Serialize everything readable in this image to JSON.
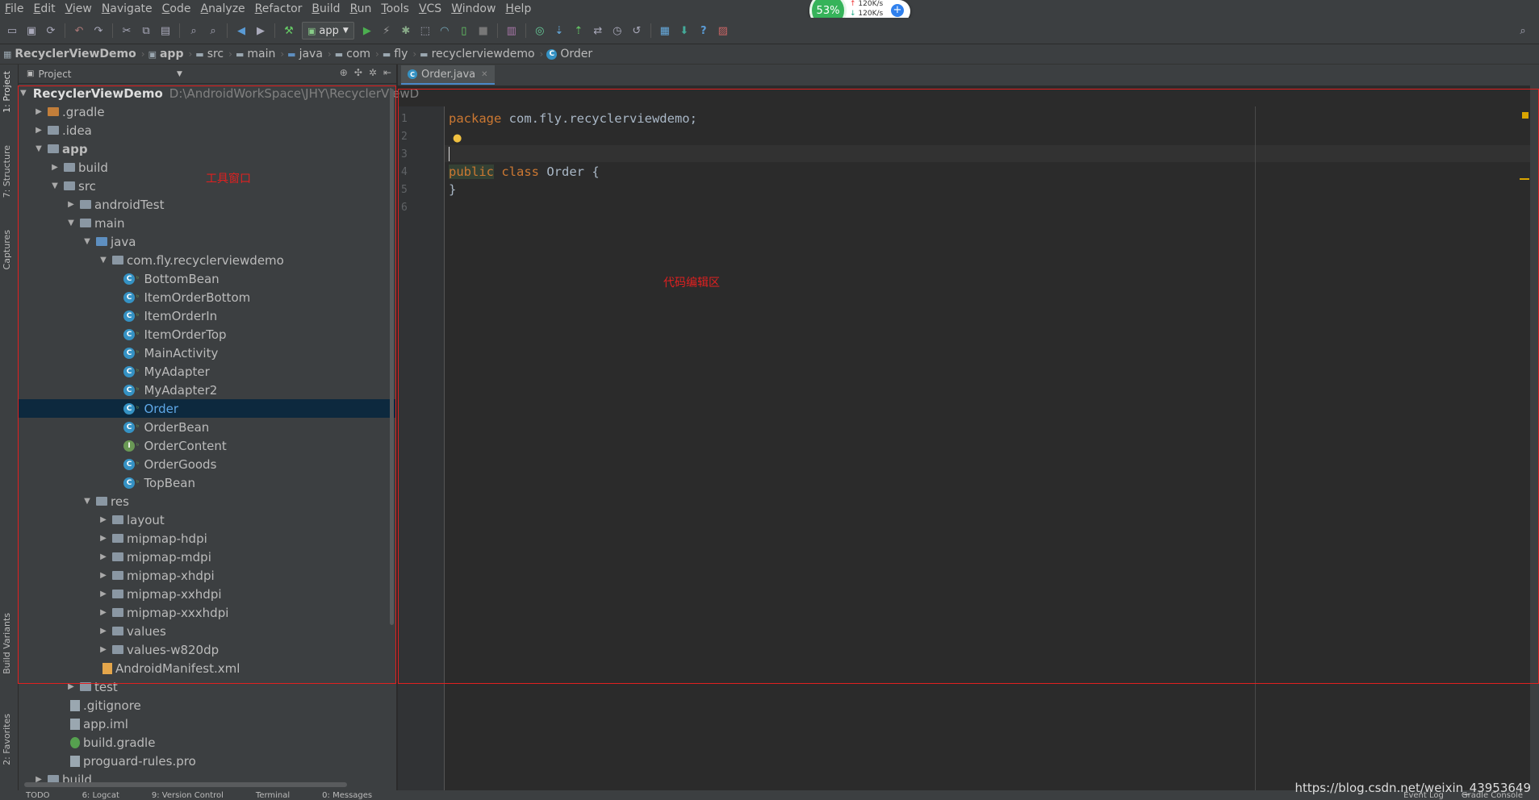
{
  "menu": [
    "File",
    "Edit",
    "View",
    "Navigate",
    "Code",
    "Analyze",
    "Refactor",
    "Build",
    "Run",
    "Tools",
    "VCS",
    "Window",
    "Help"
  ],
  "toolbar": {
    "run_config": "app"
  },
  "network": {
    "cpu": "53%",
    "up": "120K/s",
    "down": "120K/s"
  },
  "breadcrumb": [
    "RecyclerViewDemo",
    "app",
    "src",
    "main",
    "java",
    "com",
    "fly",
    "recyclerviewdemo",
    "Order"
  ],
  "left_tabs": [
    "1: Project",
    "7: Structure",
    "Captures",
    "Build Variants",
    "2: Favorites"
  ],
  "project": {
    "header": "Project",
    "root_name": "RecyclerViewDemo",
    "root_path": "D:\\AndroidWorkSpace\\JHY\\RecyclerViewD",
    "items": [
      {
        "label": ".gradle"
      },
      {
        "label": ".idea"
      },
      {
        "label": "app"
      },
      {
        "label": "build"
      },
      {
        "label": "src"
      },
      {
        "label": "androidTest"
      },
      {
        "label": "main"
      },
      {
        "label": "java"
      },
      {
        "label": "com.fly.recyclerviewdemo"
      },
      {
        "label": "BottomBean"
      },
      {
        "label": "ItemOrderBottom"
      },
      {
        "label": "ItemOrderIn"
      },
      {
        "label": "ItemOrderTop"
      },
      {
        "label": "MainActivity"
      },
      {
        "label": "MyAdapter"
      },
      {
        "label": "MyAdapter2"
      },
      {
        "label": "Order"
      },
      {
        "label": "OrderBean"
      },
      {
        "label": "OrderContent"
      },
      {
        "label": "OrderGoods"
      },
      {
        "label": "TopBean"
      },
      {
        "label": "res"
      },
      {
        "label": "layout"
      },
      {
        "label": "mipmap-hdpi"
      },
      {
        "label": "mipmap-mdpi"
      },
      {
        "label": "mipmap-xhdpi"
      },
      {
        "label": "mipmap-xxhdpi"
      },
      {
        "label": "mipmap-xxxhdpi"
      },
      {
        "label": "values"
      },
      {
        "label": "values-w820dp"
      },
      {
        "label": "AndroidManifest.xml"
      },
      {
        "label": "test"
      },
      {
        "label": ".gitignore"
      },
      {
        "label": "app.iml"
      },
      {
        "label": "build.gradle"
      },
      {
        "label": "proguard-rules.pro"
      },
      {
        "label": "build"
      }
    ]
  },
  "annotations": {
    "tool_window": "工具窗口",
    "code_editor": "代码编辑区"
  },
  "editor": {
    "tab": "Order.java",
    "line_numbers": [
      "1",
      "2",
      "3",
      "4",
      "5",
      "6"
    ],
    "code": {
      "l1_kw": "package",
      "l1_rest": " com.fly.recyclerviewdemo;",
      "l4_kw1": "public",
      "l4_kw2": "class",
      "l4_rest": " Order {",
      "l5": "}"
    }
  },
  "status": [
    "TODO",
    "6: Logcat",
    "9: Version Control",
    "Terminal",
    "0: Messages",
    "Event Log",
    "Gradle Console"
  ],
  "watermark": "https://blog.csdn.net/weixin_43953649"
}
